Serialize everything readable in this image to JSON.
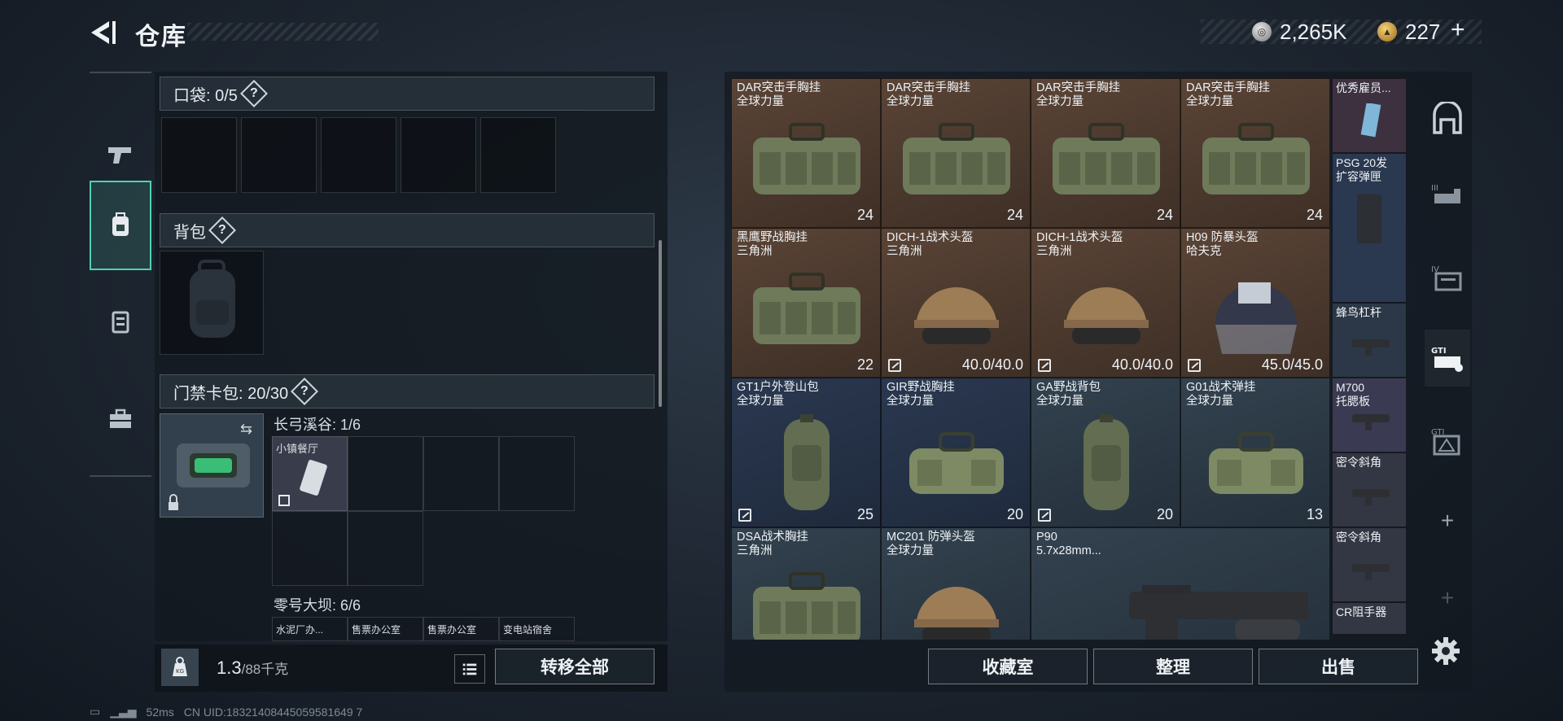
{
  "header": {
    "title": "仓库",
    "currency1": "2,265K",
    "currency2": "227"
  },
  "pockets": {
    "label": "口袋: 0/5"
  },
  "backpack": {
    "label": "背包"
  },
  "keycard": {
    "label": "门禁卡包: 20/30",
    "map1": "长弓溪谷: 1/6",
    "map1_item": "小镇餐厅",
    "map2": "零号大坝: 6/6",
    "map2_items": [
      "水泥厂办...",
      "售票办公室",
      "售票办公室",
      "变电站宿舍"
    ]
  },
  "footer": {
    "weight": "1.3",
    "weight_max": "/88千克",
    "transfer_label": "转移全部"
  },
  "stash": {
    "items": [
      {
        "name": "DAR突击手胸挂",
        "sub": "全球力量",
        "count": "24"
      },
      {
        "name": "DAR突击手胸挂",
        "sub": "全球力量",
        "count": "24"
      },
      {
        "name": "DAR突击手胸挂",
        "sub": "全球力量",
        "count": "24"
      },
      {
        "name": "DAR突击手胸挂",
        "sub": "全球力量",
        "count": "24"
      },
      {
        "name": "黑鹰野战胸挂",
        "sub": "三角洲",
        "count": "22"
      },
      {
        "name": "DICH-1战术头盔",
        "sub": "三角洲",
        "count": "40.0/40.0"
      },
      {
        "name": "DICH-1战术头盔",
        "sub": "三角洲",
        "count": "40.0/40.0"
      },
      {
        "name": "H09 防暴头盔",
        "sub": "哈夫克",
        "count": "45.0/45.0"
      },
      {
        "name": "GT1户外登山包",
        "sub": "全球力量",
        "count": "25"
      },
      {
        "name": "GIR野战胸挂",
        "sub": "全球力量",
        "count": "20"
      },
      {
        "name": "GA野战背包",
        "sub": "全球力量",
        "count": "20"
      },
      {
        "name": "G01战术弹挂",
        "sub": "全球力量",
        "count": "13"
      },
      {
        "name": "DSA战术胸挂",
        "sub": "三角洲",
        "count": ""
      },
      {
        "name": "MC201 防弹头盔",
        "sub": "全球力量",
        "count": ""
      },
      {
        "name": "P90",
        "sub": "5.7x28mm...",
        "count": ""
      }
    ],
    "side_items": [
      {
        "name": "优秀雇员..."
      },
      {
        "name": "PSG 20发\n扩容弹匣"
      },
      {
        "name": "蜂鸟杠杆"
      },
      {
        "name": "M700\n托腮板"
      },
      {
        "name": "密令斜角"
      },
      {
        "name": "密令斜角"
      },
      {
        "name": "CR阻手器"
      }
    ]
  },
  "bottom_buttons": {
    "collection": "收藏室",
    "organize": "整理",
    "sell": "出售"
  },
  "status": {
    "ping": "52ms",
    "uid": "CN UID:18321408445059581649 7"
  }
}
